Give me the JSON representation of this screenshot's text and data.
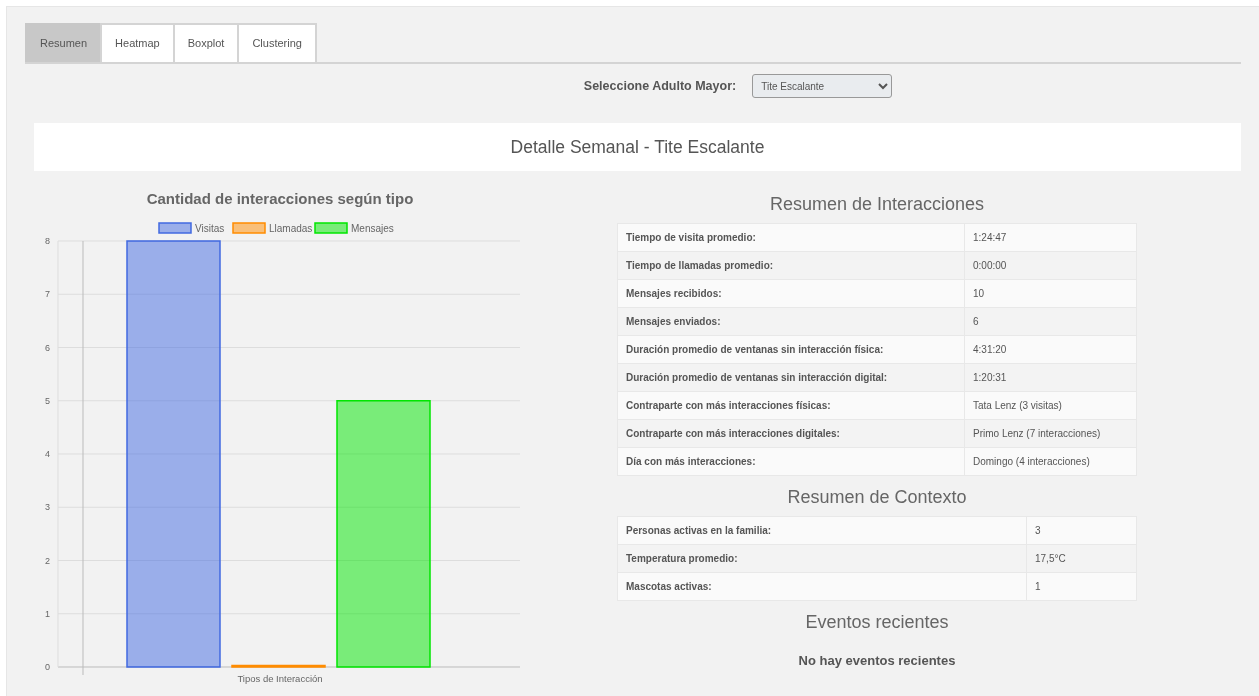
{
  "tabs": [
    {
      "label": "Resumen",
      "selected": true
    },
    {
      "label": "Heatmap",
      "selected": false
    },
    {
      "label": "Boxplot",
      "selected": false
    },
    {
      "label": "Clustering",
      "selected": false
    }
  ],
  "selector": {
    "label": "Seleccione Adulto Mayor:",
    "value": "Tite Escalante"
  },
  "banner": {
    "title": "Detalle Semanal - Tite Escalante"
  },
  "chart": {
    "chart_data": {
      "type": "bar",
      "title": "Cantidad de interacciones según tipo",
      "xlabel": "Tipos de Interacción",
      "ylim": [
        0,
        8
      ],
      "grid": true,
      "legend": true,
      "yticks": [
        {
          "value": 0,
          "label": "0"
        },
        {
          "value": 1,
          "label": "1"
        },
        {
          "value": 2,
          "label": "2"
        },
        {
          "value": 3,
          "label": "3"
        },
        {
          "value": 4,
          "label": "4"
        },
        {
          "value": 5,
          "label": "5"
        },
        {
          "value": 6,
          "label": "6"
        },
        {
          "value": 7,
          "label": "7"
        },
        {
          "value": 8,
          "label": "8"
        }
      ],
      "series": [
        {
          "name": "Visitas",
          "color": "#4169e1",
          "values": [
            8
          ]
        },
        {
          "name": "Llamadas",
          "color": "#ff8c00",
          "values": [
            0
          ]
        },
        {
          "name": "Mensajes",
          "color": "#00e600",
          "values": [
            5
          ]
        }
      ]
    }
  },
  "interactions": {
    "title": "Resumen de Interacciones",
    "rows": [
      {
        "label": "Tiempo de visita promedio:",
        "value": "1:24:47"
      },
      {
        "label": "Tiempo de llamadas promedio:",
        "value": "0:00:00"
      },
      {
        "label": "Mensajes recibidos:",
        "value": "10"
      },
      {
        "label": "Mensajes enviados:",
        "value": "6"
      },
      {
        "label": "Duración promedio de ventanas sin interacción física:",
        "value": "4:31:20"
      },
      {
        "label": "Duración promedio de ventanas sin interacción digital:",
        "value": "1:20:31"
      },
      {
        "label": "Contraparte con más interacciones físicas:",
        "value": "Tata Lenz (3 visitas)"
      },
      {
        "label": "Contraparte con más interacciones digitales:",
        "value": "Primo Lenz (7 interacciones)"
      },
      {
        "label": "Día con más interacciones:",
        "value": "Domingo (4 interacciones)"
      }
    ]
  },
  "context": {
    "title": "Resumen de Contexto",
    "rows": [
      {
        "label": "Personas activas en la familia:",
        "value": "3"
      },
      {
        "label": "Temperatura promedio:",
        "value": "17,5°C"
      },
      {
        "label": "Mascotas activas:",
        "value": "1"
      }
    ]
  },
  "events": {
    "title": "Eventos recientes",
    "empty_text": "No hay eventos recientes"
  }
}
